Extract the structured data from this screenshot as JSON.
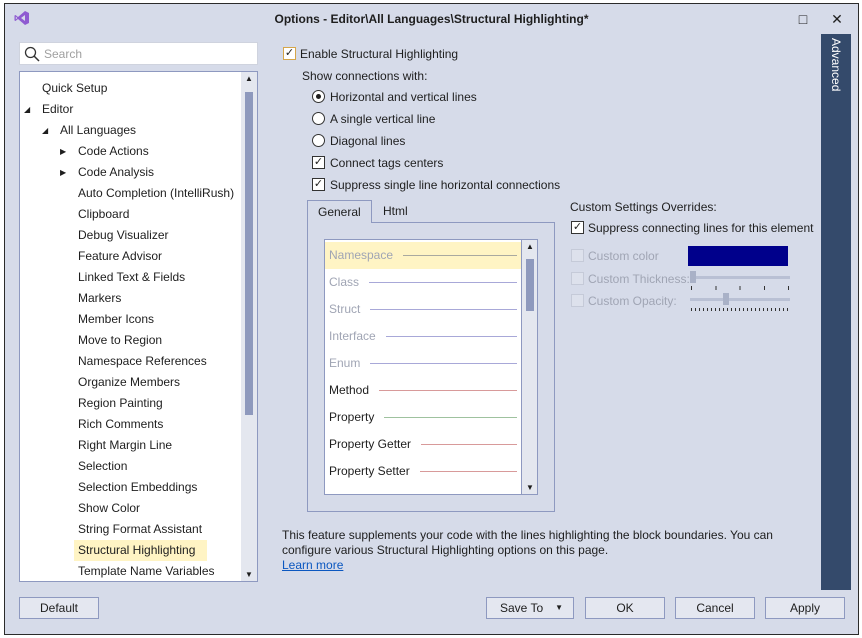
{
  "window": {
    "title": "Options - Editor\\All Languages\\Structural Highlighting*",
    "maximize_icon": "□",
    "close_icon": "✕"
  },
  "search": {
    "placeholder": "Search"
  },
  "tree": [
    {
      "label": "Quick Setup",
      "level": 0,
      "arrow": ""
    },
    {
      "label": "Editor",
      "level": 0,
      "arrow": "◢"
    },
    {
      "label": "All Languages",
      "level": 1,
      "arrow": "◢"
    },
    {
      "label": "Code Actions",
      "level": 2,
      "arrow": "▶"
    },
    {
      "label": "Code Analysis",
      "level": 2,
      "arrow": "▶"
    },
    {
      "label": "Auto Completion (IntelliRush)",
      "level": 2,
      "arrow": ""
    },
    {
      "label": "Clipboard",
      "level": 2,
      "arrow": ""
    },
    {
      "label": "Debug Visualizer",
      "level": 2,
      "arrow": ""
    },
    {
      "label": "Feature Advisor",
      "level": 2,
      "arrow": ""
    },
    {
      "label": "Linked Text & Fields",
      "level": 2,
      "arrow": ""
    },
    {
      "label": "Markers",
      "level": 2,
      "arrow": ""
    },
    {
      "label": "Member Icons",
      "level": 2,
      "arrow": ""
    },
    {
      "label": "Move to Region",
      "level": 2,
      "arrow": ""
    },
    {
      "label": "Namespace References",
      "level": 2,
      "arrow": ""
    },
    {
      "label": "Organize Members",
      "level": 2,
      "arrow": ""
    },
    {
      "label": "Region Painting",
      "level": 2,
      "arrow": ""
    },
    {
      "label": "Rich Comments",
      "level": 2,
      "arrow": ""
    },
    {
      "label": "Right Margin Line",
      "level": 2,
      "arrow": ""
    },
    {
      "label": "Selection",
      "level": 2,
      "arrow": ""
    },
    {
      "label": "Selection Embeddings",
      "level": 2,
      "arrow": ""
    },
    {
      "label": "Show Color",
      "level": 2,
      "arrow": ""
    },
    {
      "label": "String Format Assistant",
      "level": 2,
      "arrow": ""
    },
    {
      "label": "Structural Highlighting",
      "level": 2,
      "arrow": "",
      "selected": true
    },
    {
      "label": "Template Name Variables",
      "level": 2,
      "arrow": ""
    }
  ],
  "options": {
    "enable": {
      "label": "Enable Structural Highlighting",
      "checked": true
    },
    "show_connections_label": "Show connections with:",
    "radios": [
      {
        "label": "Horizontal and vertical lines",
        "selected": true
      },
      {
        "label": "A single vertical line",
        "selected": false
      },
      {
        "label": "Diagonal lines",
        "selected": false
      }
    ],
    "connect_tags": {
      "label": "Connect tags centers",
      "checked": true
    },
    "suppress_single": {
      "label": "Suppress single line horizontal connections",
      "checked": true
    }
  },
  "tabs": [
    {
      "label": "General",
      "active": true
    },
    {
      "label": "Html",
      "active": false
    }
  ],
  "elements": [
    {
      "label": "Namespace",
      "color": "#a9a9a0",
      "enabled": false,
      "selected": true
    },
    {
      "label": "Class",
      "color": "#a8a8d8",
      "enabled": false
    },
    {
      "label": "Struct",
      "color": "#a8a8d8",
      "enabled": false
    },
    {
      "label": "Interface",
      "color": "#a8a8d8",
      "enabled": false
    },
    {
      "label": "Enum",
      "color": "#a8a8d8",
      "enabled": false
    },
    {
      "label": "Method",
      "color": "#d89a9a",
      "enabled": true
    },
    {
      "label": "Property",
      "color": "#9fc29f",
      "enabled": true
    },
    {
      "label": "Property Getter",
      "color": "#d89a9a",
      "enabled": true
    },
    {
      "label": "Property Setter",
      "color": "#d89a9a",
      "enabled": true
    }
  ],
  "overrides": {
    "title": "Custom Settings Overrides:",
    "suppress": {
      "label": "Suppress connecting lines for this element",
      "checked": true
    },
    "custom_color": {
      "label": "Custom color",
      "checked": false,
      "value": "#00008b"
    },
    "custom_thickness": {
      "label": "Custom Thickness:",
      "checked": false,
      "level": 0
    },
    "custom_opacity": {
      "label": "Custom Opacity:",
      "checked": false,
      "level": 0.35
    }
  },
  "advanced_tab": "Advanced",
  "description": "This feature supplements your code with the lines highlighting the block boundaries. You can configure various Structural Highlighting options on this page.",
  "learn_more": "Learn more",
  "buttons": {
    "default": "Default",
    "save_to": "Save To",
    "ok": "OK",
    "cancel": "Cancel",
    "apply": "Apply"
  }
}
